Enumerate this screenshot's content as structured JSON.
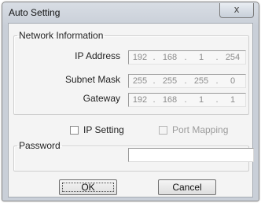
{
  "window": {
    "title": "Auto Setting",
    "close_glyph": "x"
  },
  "network": {
    "legend": "Network Information",
    "ip_address": {
      "label": "IP Address",
      "octets": [
        "192",
        "168",
        "1",
        "254"
      ]
    },
    "subnet_mask": {
      "label": "Subnet Mask",
      "octets": [
        "255",
        "255",
        "255",
        "0"
      ]
    },
    "gateway": {
      "label": "Gateway",
      "octets": [
        "192",
        "168",
        "1",
        "1"
      ]
    },
    "separator": "."
  },
  "options": {
    "ip_setting": {
      "label": "IP Setting",
      "checked": false,
      "enabled": true
    },
    "port_mapping": {
      "label": "Port Mapping",
      "checked": false,
      "enabled": false
    }
  },
  "password": {
    "legend": "Password",
    "value": ""
  },
  "buttons": {
    "ok": "OK",
    "cancel": "Cancel"
  }
}
